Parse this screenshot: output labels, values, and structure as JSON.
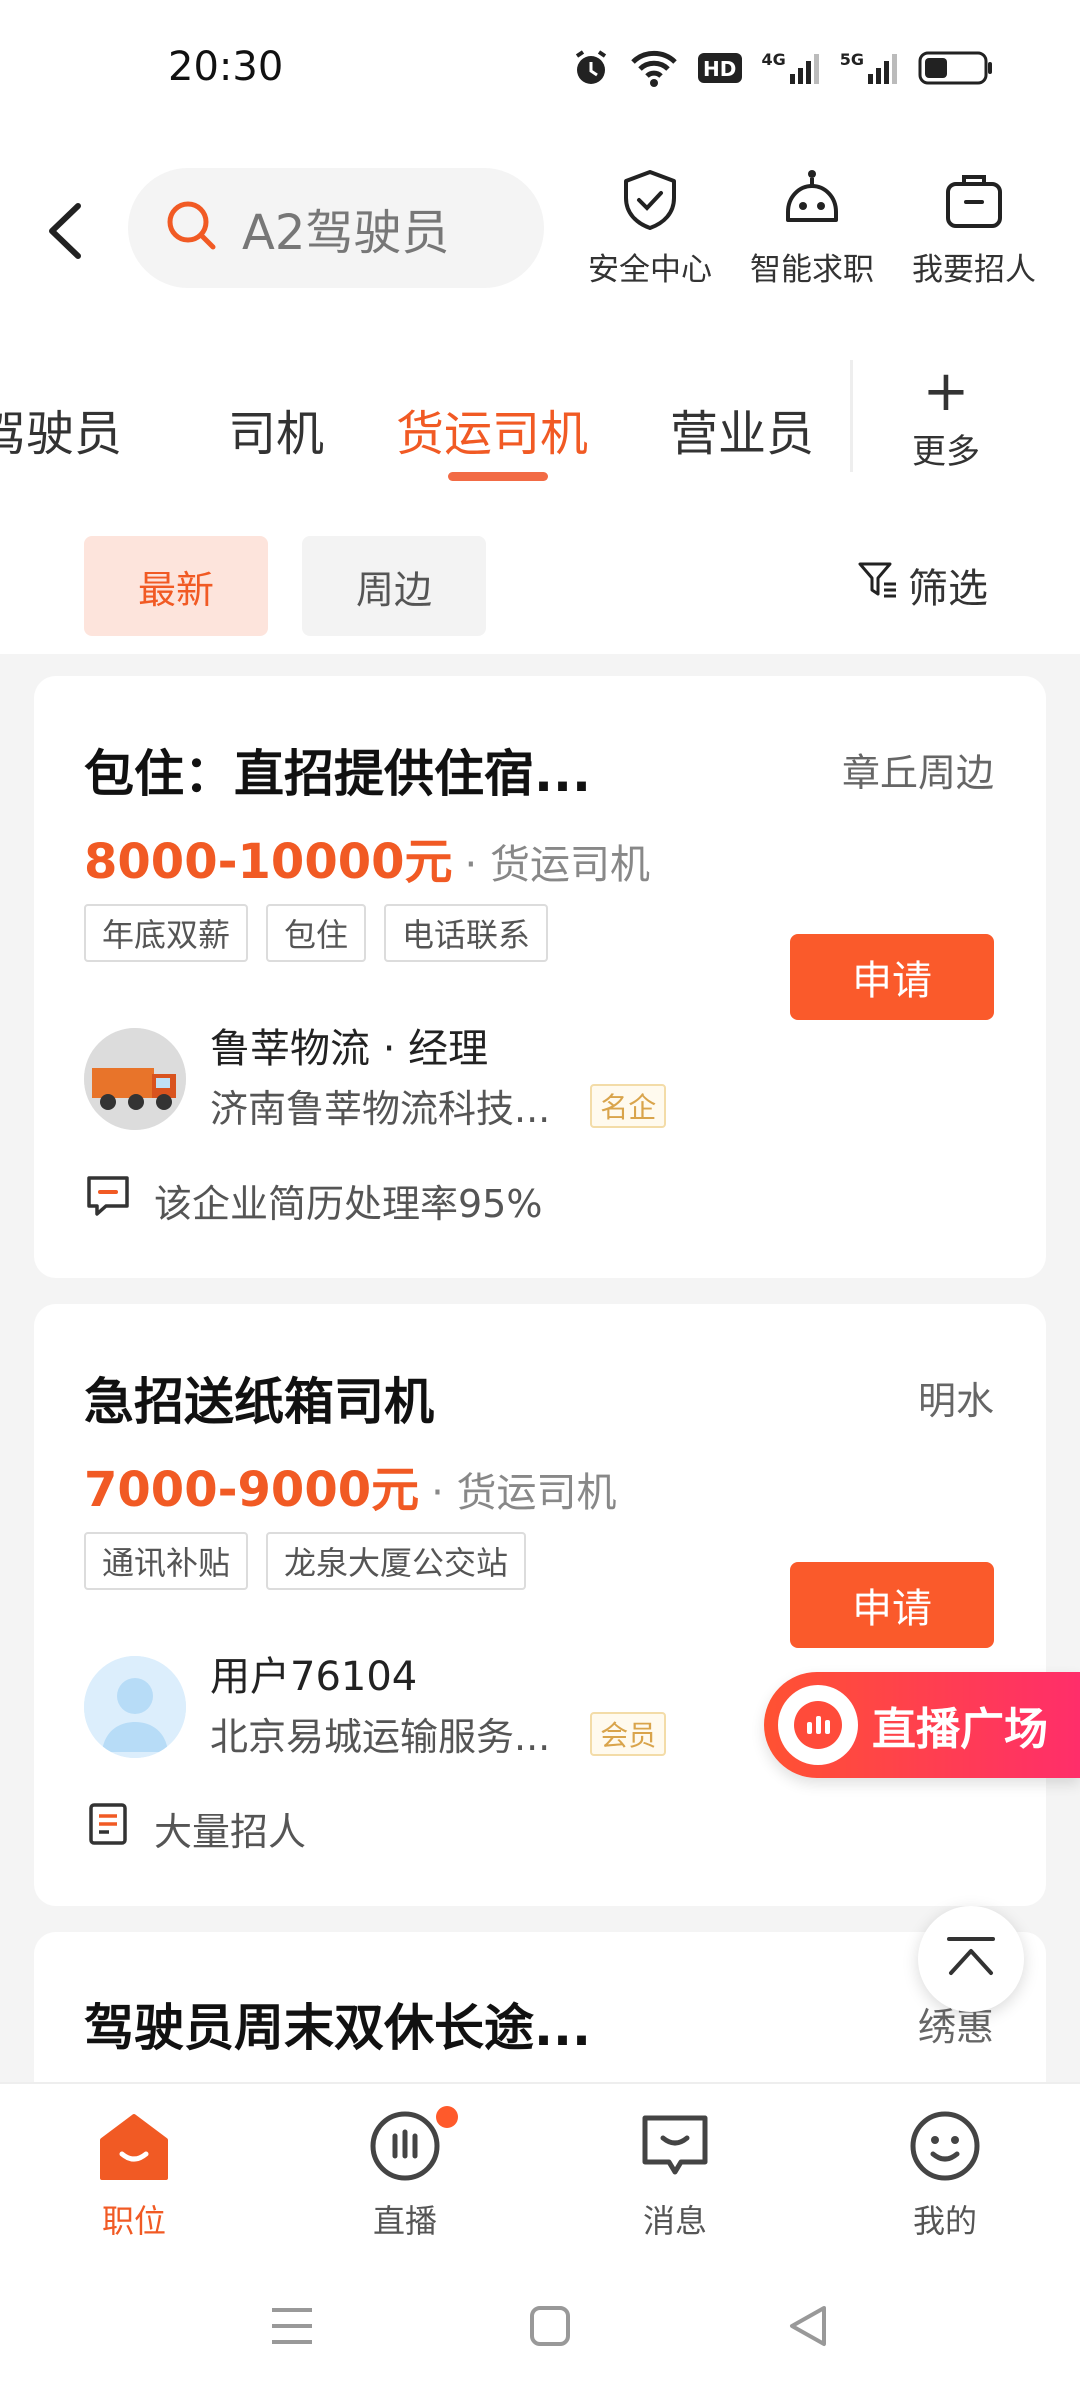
{
  "status_bar": {
    "time": "20:30",
    "net_4g": "4G",
    "net_5g": "5G"
  },
  "header": {
    "search_text": "A2驾驶员",
    "actions": [
      {
        "label": "安全中心",
        "icon": "shield-check-icon"
      },
      {
        "label": "智能求职",
        "icon": "robot-icon"
      },
      {
        "label": "我要招人",
        "icon": "briefcase-icon"
      }
    ]
  },
  "categories": {
    "tabs": [
      "驾驶员",
      "司机",
      "货运司机",
      "营业员"
    ],
    "active_index": 2,
    "more_label": "更多"
  },
  "filters": {
    "latest": "最新",
    "nearby": "周边",
    "filter_label": "筛选"
  },
  "jobs": [
    {
      "title": "包住：直招提供住宿...",
      "location": "章丘周边",
      "salary": "8000-10000元",
      "category": "· 货运司机",
      "tags": [
        "年底双薪",
        "包住",
        "电话联系"
      ],
      "apply": "申请",
      "recruiter": "鲁莘物流 · 经理",
      "company": "济南鲁莘物流科技...",
      "badge": "名企",
      "note": "该企业简历处理率95%"
    },
    {
      "title": "急招送纸箱司机",
      "location": "明水",
      "salary": "7000-9000元",
      "category": "· 货运司机",
      "tags": [
        "通讯补贴",
        "龙泉大厦公交站"
      ],
      "apply": "申请",
      "recruiter": "用户76104",
      "company": "北京易城运输服务...",
      "badge": "会员",
      "note": "大量招人"
    },
    {
      "title": "驾驶员周末双休长途...",
      "location": "绣惠"
    }
  ],
  "live_banner": "直播广场",
  "bottom_nav": [
    {
      "label": "职位",
      "icon": "home-icon"
    },
    {
      "label": "直播",
      "icon": "live-icon"
    },
    {
      "label": "消息",
      "icon": "message-icon"
    },
    {
      "label": "我的",
      "icon": "profile-icon"
    }
  ],
  "colors": {
    "accent": "#f15a24",
    "apply": "#fa5a2b",
    "badge": "#d9a44b"
  }
}
